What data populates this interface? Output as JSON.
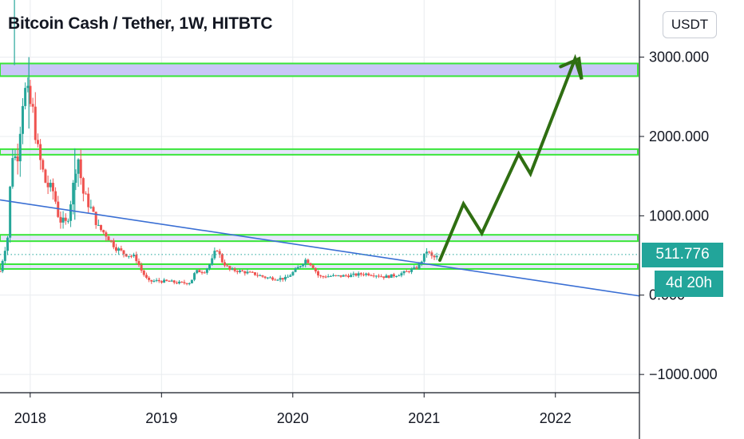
{
  "header": {
    "title": "Bitcoin Cash / Tether, 1W, HITBTC",
    "currency_button": "USDT"
  },
  "price_label": "511.776",
  "countdown_label": "4d 20h",
  "colors": {
    "up": "#26a69a",
    "down": "#ef5350",
    "zone_fill": "#c9c6f8",
    "zone_border": "#39e639",
    "trendline": "#3a6fd4",
    "projection": "#2f6e12",
    "badge": "#22a59a",
    "axis": "#131722",
    "grid": "#e9ecef"
  },
  "chart_data": {
    "type": "candlestick",
    "title": "Bitcoin Cash / Tether, 1W, HITBTC",
    "y_ticks": [
      {
        "value": 3000,
        "label": "3000.000"
      },
      {
        "value": 2000,
        "label": "2000.000"
      },
      {
        "value": 1000,
        "label": "1000.000"
      },
      {
        "value": 0,
        "label": "0.000"
      },
      {
        "value": -1000,
        "label": "−1000.000"
      }
    ],
    "x_ticks": [
      {
        "value": 2018.0,
        "label": "2018"
      },
      {
        "value": 2019.0,
        "label": "2019"
      },
      {
        "value": 2020.0,
        "label": "2020"
      },
      {
        "value": 2021.0,
        "label": "2021"
      },
      {
        "value": 2022.0,
        "label": "2022"
      }
    ],
    "xlim": [
      2017.77,
      2022.64
    ],
    "ylim": [
      -1230,
      3720
    ],
    "last_price": 511.776,
    "zones": [
      {
        "low": 2760,
        "high": 2920
      },
      {
        "low": 1770,
        "high": 1840
      },
      {
        "low": 680,
        "high": 760
      },
      {
        "low": 330,
        "high": 390
      }
    ],
    "trendline": [
      [
        2017.77,
        1200
      ],
      [
        2022.64,
        -10
      ]
    ],
    "projection": [
      [
        2021.12,
        440
      ],
      [
        2021.3,
        1150
      ],
      [
        2021.44,
        780
      ],
      [
        2021.72,
        1780
      ],
      [
        2021.81,
        1530
      ],
      [
        2022.15,
        2980
      ],
      [
        2022.2,
        2720
      ],
      [
        2022.18,
        2980
      ],
      [
        2022.04,
        2880
      ]
    ],
    "price_anchors": [
      [
        2017.77,
        300
      ],
      [
        2017.83,
        750
      ],
      [
        2017.86,
        1800
      ],
      [
        2017.9,
        1700
      ],
      [
        2017.95,
        2600
      ],
      [
        2017.98,
        2500
      ],
      [
        2018.02,
        2300
      ],
      [
        2018.06,
        1800
      ],
      [
        2018.12,
        1400
      ],
      [
        2018.18,
        1300
      ],
      [
        2018.22,
        950
      ],
      [
        2018.28,
        900
      ],
      [
        2018.33,
        1400
      ],
      [
        2018.36,
        1800
      ],
      [
        2018.4,
        1300
      ],
      [
        2018.46,
        1100
      ],
      [
        2018.52,
        850
      ],
      [
        2018.58,
        760
      ],
      [
        2018.65,
        600
      ],
      [
        2018.72,
        520
      ],
      [
        2018.8,
        480
      ],
      [
        2018.85,
        300
      ],
      [
        2018.9,
        170
      ],
      [
        2018.96,
        180
      ],
      [
        2019.06,
        170
      ],
      [
        2019.15,
        150
      ],
      [
        2019.22,
        160
      ],
      [
        2019.26,
        300
      ],
      [
        2019.33,
        300
      ],
      [
        2019.38,
        420
      ],
      [
        2019.42,
        600
      ],
      [
        2019.46,
        430
      ],
      [
        2019.52,
        320
      ],
      [
        2019.6,
        300
      ],
      [
        2019.7,
        270
      ],
      [
        2019.8,
        220
      ],
      [
        2019.88,
        210
      ],
      [
        2019.95,
        210
      ],
      [
        2020.03,
        330
      ],
      [
        2020.1,
        450
      ],
      [
        2020.15,
        370
      ],
      [
        2020.2,
        230
      ],
      [
        2020.28,
        240
      ],
      [
        2020.36,
        240
      ],
      [
        2020.45,
        250
      ],
      [
        2020.55,
        270
      ],
      [
        2020.62,
        260
      ],
      [
        2020.7,
        230
      ],
      [
        2020.78,
        250
      ],
      [
        2020.86,
        290
      ],
      [
        2020.94,
        340
      ],
      [
        2020.98,
        430
      ],
      [
        2021.02,
        560
      ],
      [
        2021.06,
        480
      ],
      [
        2021.09,
        470
      ],
      [
        2021.11,
        500
      ]
    ]
  }
}
